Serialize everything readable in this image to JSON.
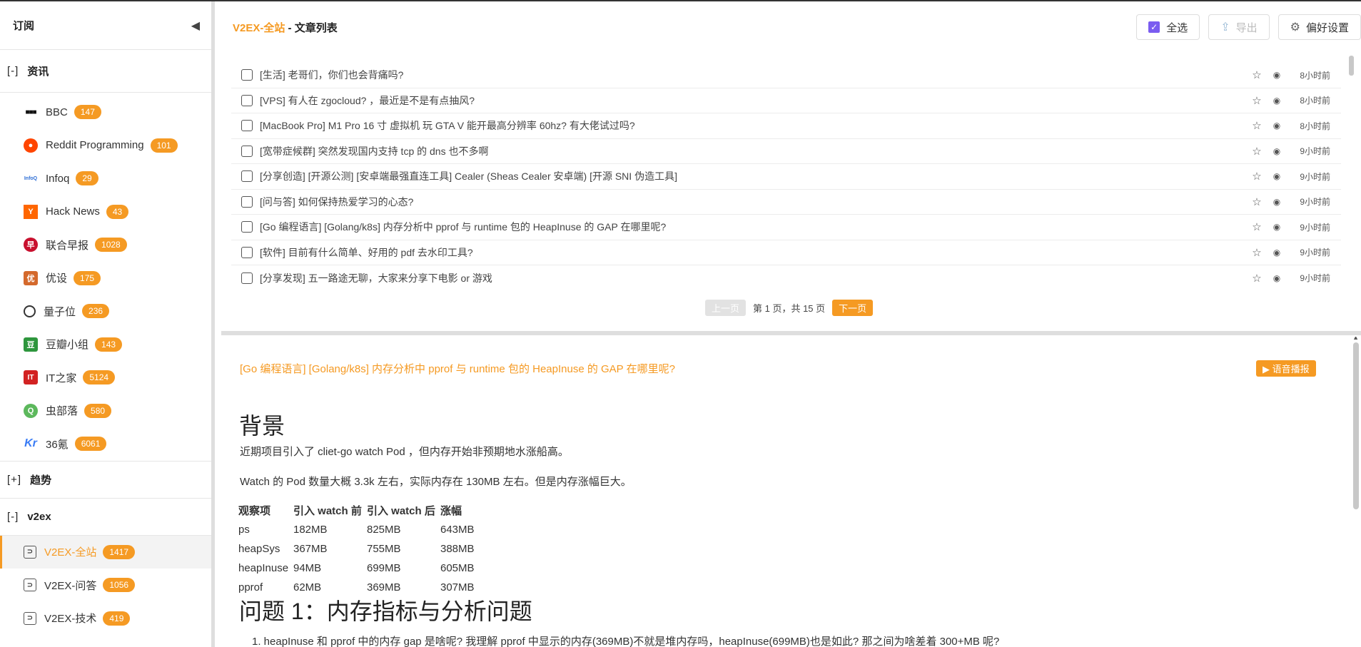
{
  "sidebar": {
    "title": "订阅",
    "groups": [
      {
        "toggle": "[-]",
        "name": "资讯"
      },
      {
        "toggle": "[+]",
        "name": "趋势"
      },
      {
        "toggle": "[-]",
        "name": "v2ex"
      }
    ],
    "news_feeds": [
      {
        "name": "BBC",
        "count": "147",
        "icon": "bbc-icon",
        "color": "#111111"
      },
      {
        "name": "Reddit Programming",
        "count": "101",
        "icon": "reddit-icon",
        "color": "#ff4500"
      },
      {
        "name": "Infoq",
        "count": "29",
        "icon": "infoq-icon",
        "color": "#2f6fd6"
      },
      {
        "name": "Hack News",
        "count": "43",
        "icon": "hackernews-icon",
        "color": "#ff6600"
      },
      {
        "name": "联合早报",
        "count": "1028",
        "icon": "zaobao-icon",
        "color": "#c8102e"
      },
      {
        "name": "优设",
        "count": "175",
        "icon": "uisdc-icon",
        "color": "#d4692c"
      },
      {
        "name": "量子位",
        "count": "236",
        "icon": "qbitai-icon",
        "color": "#333333"
      },
      {
        "name": "豆瓣小组",
        "count": "143",
        "icon": "douban-icon",
        "color": "#2e963d"
      },
      {
        "name": "IT之家",
        "count": "5124",
        "icon": "ithome-icon",
        "color": "#d22222"
      },
      {
        "name": "虫部落",
        "count": "580",
        "icon": "chongbuluo-icon",
        "color": "#5cb85c"
      },
      {
        "name": "36氪",
        "count": "6061",
        "icon": "36kr-icon",
        "color": "#3a7cf5"
      }
    ],
    "v2ex_feeds": [
      {
        "name": "V2EX-全站",
        "count": "1417",
        "icon": "v2ex-icon",
        "active": true
      },
      {
        "name": "V2EX-问答",
        "count": "1056",
        "icon": "v2ex-icon"
      },
      {
        "name": "V2EX-技术",
        "count": "419",
        "icon": "v2ex-icon"
      }
    ]
  },
  "header": {
    "source": "V2EX-全站",
    "suffix": " - 文章列表",
    "select_all": "全选",
    "export": "导出",
    "preferences": "偏好设置"
  },
  "articles": [
    {
      "title": "[生活] 老哥们，你们也会背痛吗?",
      "time": "8小时前"
    },
    {
      "title": "[VPS] 有人在 zgocloud? ，最近是不是有点抽风?",
      "time": "8小时前"
    },
    {
      "title": "[MacBook Pro] M1 Pro 16 寸 虚拟机 玩 GTA V 能开最高分辨率 60hz? 有大佬试过吗?",
      "time": "8小时前"
    },
    {
      "title": "[宽带症候群] 突然发现国内支持 tcp 的 dns 也不多啊",
      "time": "9小时前"
    },
    {
      "title": "[分享创造] [开源公测] [安卓端最强直连工具] Cealer (Sheas Cealer 安卓端) [开源 SNI 伪造工具]",
      "time": "9小时前"
    },
    {
      "title": "[问与答] 如何保持热爱学习的心态?",
      "time": "9小时前"
    },
    {
      "title": "[Go 编程语言] [Golang/k8s] 内存分析中 pprof 与 runtime 包的 HeapInuse 的 GAP 在哪里呢?",
      "time": "9小时前"
    },
    {
      "title": "[软件] 目前有什么简单、好用的 pdf 去水印工具?",
      "time": "9小时前"
    },
    {
      "title": "[分享发现] 五一路途无聊，大家来分享下电影 or 游戏",
      "time": "9小时前"
    }
  ],
  "pager": {
    "prev": "上一页",
    "info": "第 1 页，共 15 页",
    "next": "下一页"
  },
  "reader": {
    "title": "[Go 编程语言] [Golang/k8s] 内存分析中 pprof 与 runtime 包的 HeapInuse 的 GAP 在哪里呢?",
    "voice": "▶ 语音播报",
    "h_background": "背景",
    "p1": "近期项目引入了 cliet-go watch Pod ，但内存开始非预期地水涨船高。",
    "p2": "Watch 的 Pod 数量大概 3.3k 左右，实际内存在 130MB 左右。但是内存涨幅巨大。",
    "table": {
      "headers": [
        "观察项",
        "引入 watch 前",
        "引入 watch 后",
        "涨幅"
      ],
      "rows": [
        [
          "ps",
          "182MB",
          "825MB",
          "643MB"
        ],
        [
          "heapSys",
          "367MB",
          "755MB",
          "388MB"
        ],
        [
          "heapInuse",
          "94MB",
          "699MB",
          "605MB"
        ],
        [
          "pprof",
          "62MB",
          "369MB",
          "307MB"
        ]
      ]
    },
    "h_question": "问题 1：内存指标与分析问题",
    "li1": "1. heapInuse 和 pprof 中的内存 gap 是啥呢? 我理解 pprof 中显示的内存(369MB)不就是堆内存吗，heapInuse(699MB)也是如此? 那之间为啥差着 300+MB 呢?"
  },
  "colors": {
    "accent": "#f59a23",
    "check": "#7a5cf0"
  }
}
